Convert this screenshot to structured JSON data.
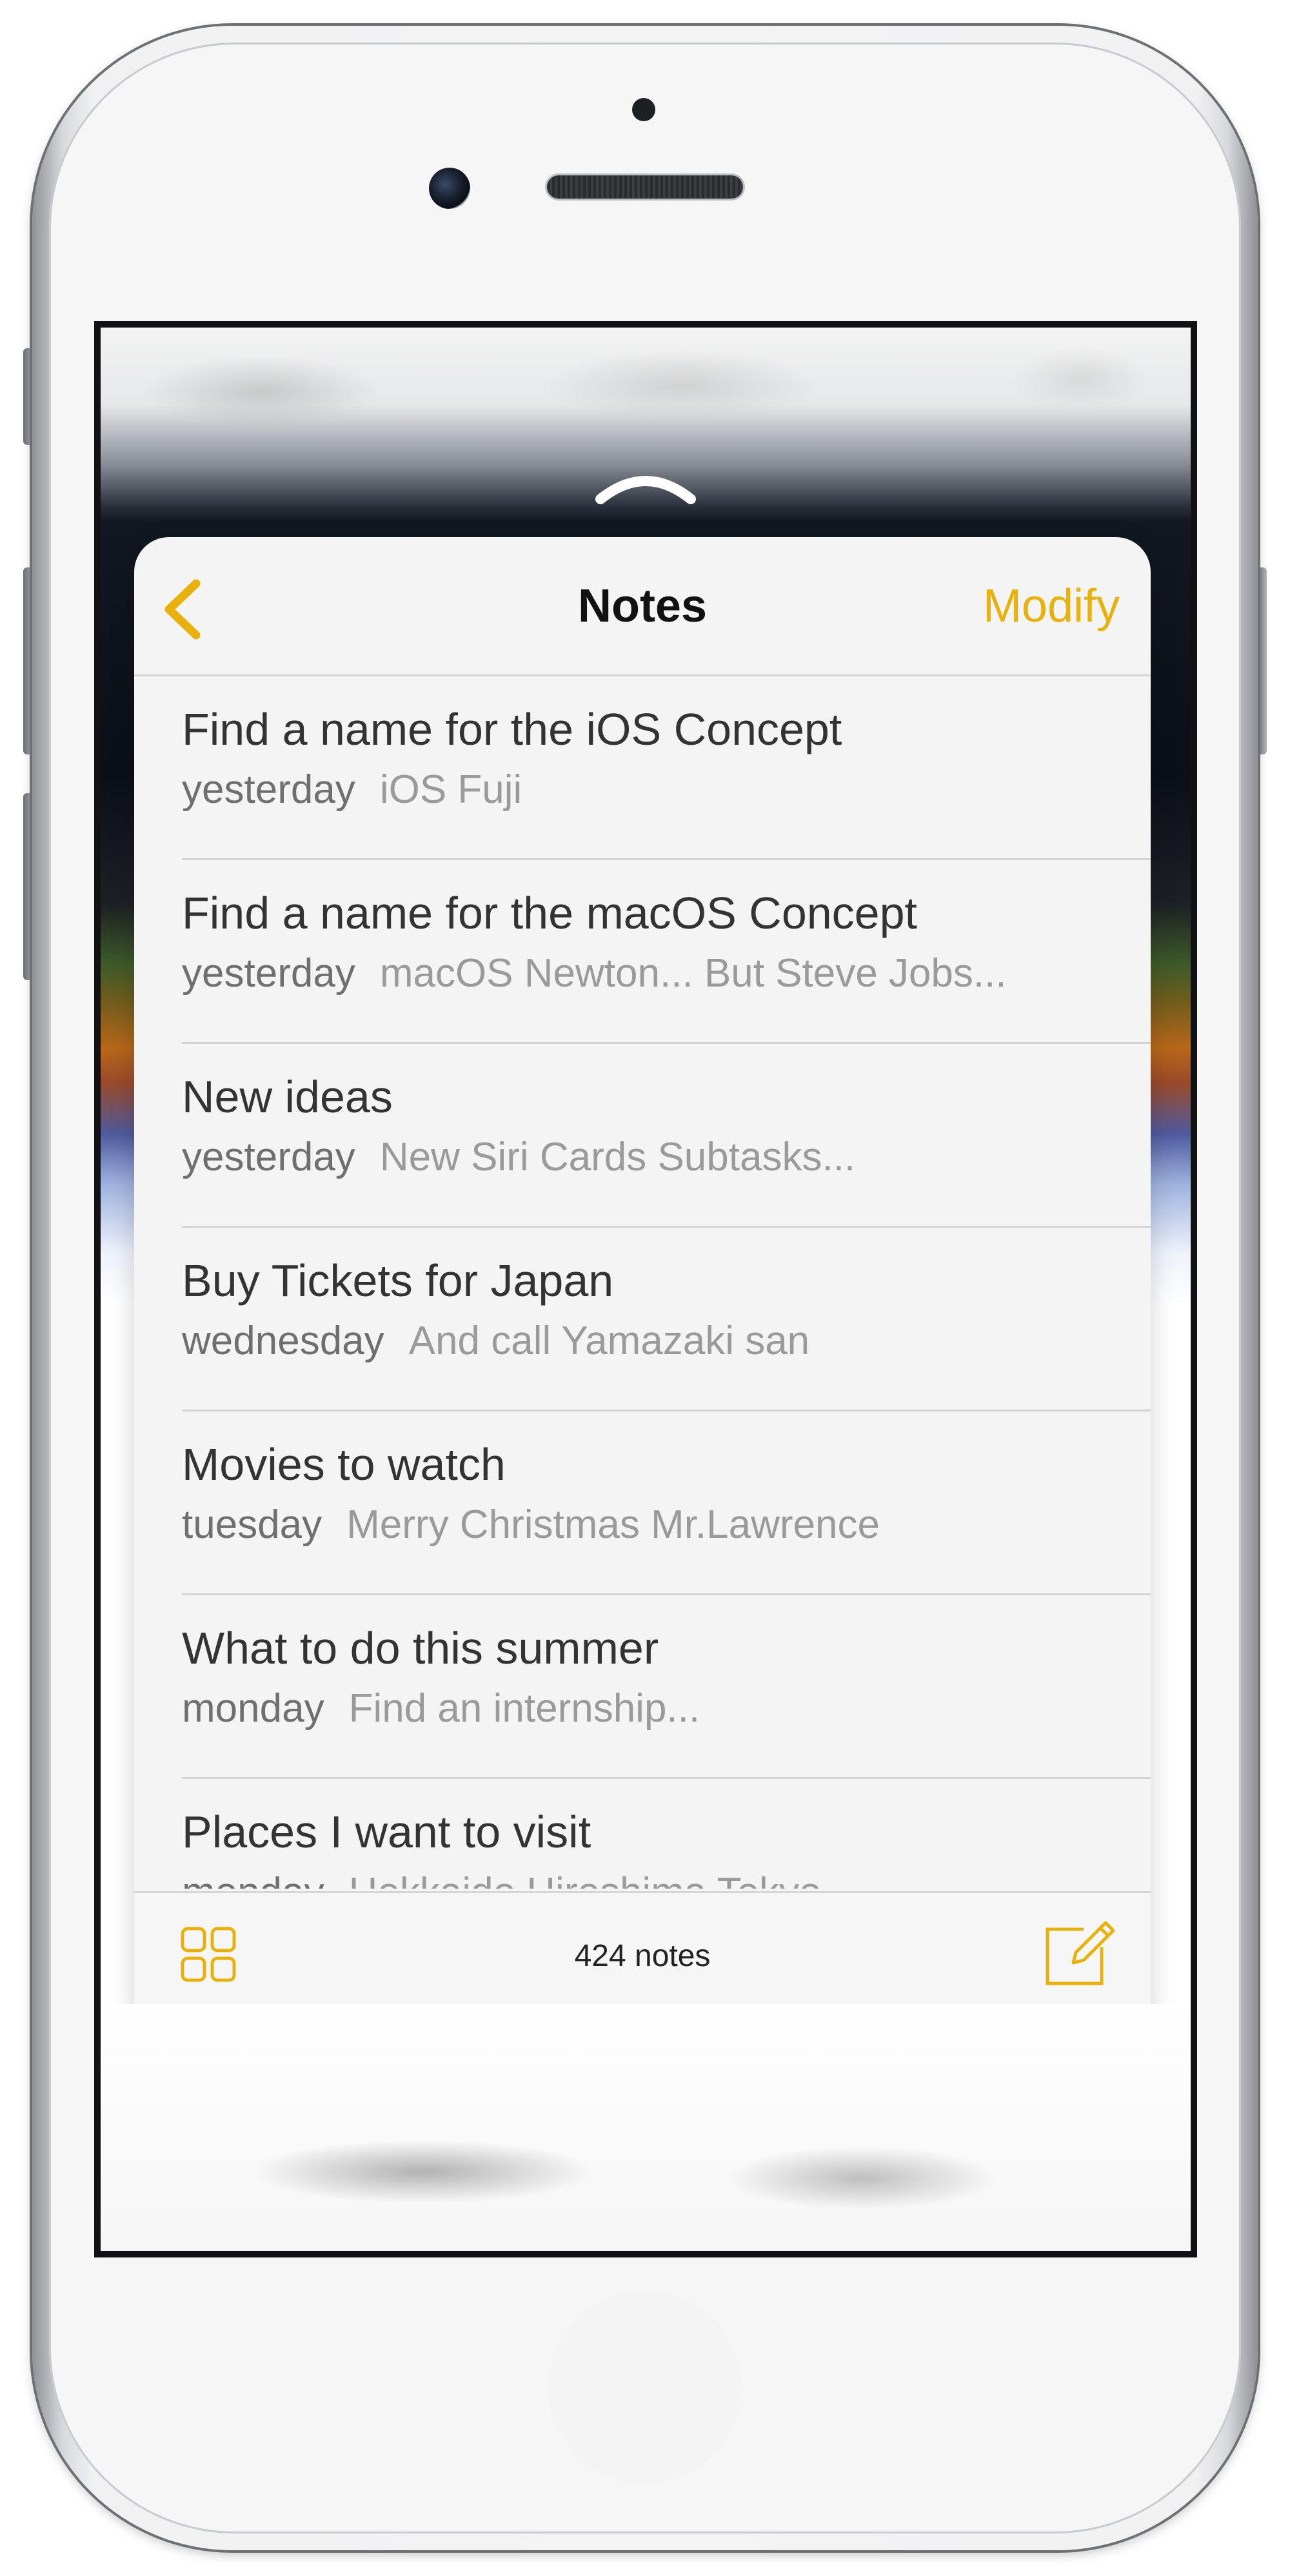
{
  "colors": {
    "accent": "#e8b10c",
    "title_text": "#333333",
    "date_text": "#6f6f6f",
    "preview_text": "#9a9a9a"
  },
  "header": {
    "back_icon": "chevron-left-icon",
    "title": "Notes",
    "modify_label": "Modify"
  },
  "notes": [
    {
      "title": "Find a name for the iOS Concept",
      "date": "yesterday",
      "preview": "iOS Fuji"
    },
    {
      "title": "Find a name for the macOS Concept",
      "date": "yesterday",
      "preview": "macOS Newton... But Steve Jobs..."
    },
    {
      "title": "New ideas",
      "date": "yesterday",
      "preview": "New Siri Cards Subtasks..."
    },
    {
      "title": "Buy Tickets for Japan",
      "date": "wednesday",
      "preview": "And call Yamazaki san"
    },
    {
      "title": "Movies to watch",
      "date": "tuesday",
      "preview": "Merry Christmas Mr.Lawrence"
    },
    {
      "title": "What to do this summer",
      "date": "monday",
      "preview": "Find an internship..."
    },
    {
      "title": "Places I want to visit",
      "date": "monday",
      "preview": "Hokkaido Hiroshima Tokyo..."
    }
  ],
  "toolbar": {
    "folders_icon": "grid-icon",
    "count_label": "424 notes",
    "compose_icon": "compose-icon"
  },
  "screen": {
    "swipe_icon": "chevron-up-icon"
  }
}
